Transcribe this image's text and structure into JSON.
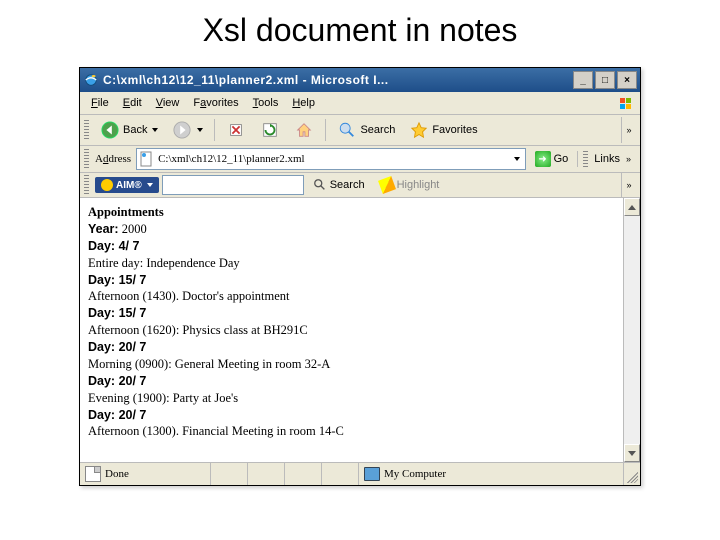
{
  "slide_title": "Xsl document in notes",
  "window": {
    "title": "C:\\xml\\ch12\\12_11\\planner2.xml - Microsoft I...",
    "min_label": "_",
    "max_label": "□",
    "close_label": "×"
  },
  "menu": {
    "file": "File",
    "edit": "Edit",
    "view": "View",
    "favorites": "Favorites",
    "tools": "Tools",
    "help": "Help"
  },
  "toolbar": {
    "back": "Back",
    "search": "Search",
    "favorites": "Favorites",
    "overflow": "»"
  },
  "address": {
    "label": "Address",
    "value": "C:\\xml\\ch12\\12_11\\planner2.xml",
    "go": "Go",
    "links": "Links",
    "overflow": "»"
  },
  "aim": {
    "brand": "AIM®",
    "search": "Search",
    "highlight": "Highlight",
    "overflow": "»"
  },
  "content": {
    "heading": "Appointments",
    "year_label": "Year:",
    "year_value": "2000",
    "entries": [
      {
        "day": "Day: 4/ 7",
        "line": "Entire day: Independence Day"
      },
      {
        "day": "Day: 15/ 7",
        "line": "Afternoon (1430). Doctor's appointment"
      },
      {
        "day": "Day: 15/ 7",
        "line": "Afternoon (1620): Physics class at BH291C"
      },
      {
        "day": "Day: 20/ 7",
        "line": "Morning (0900): General Meeting in room 32-A"
      },
      {
        "day": "Day: 20/ 7",
        "line": "Evening (1900): Party at Joe's"
      },
      {
        "day": "Day: 20/ 7",
        "line": "Afternoon (1300). Financial Meeting in room 14-C"
      }
    ]
  },
  "status": {
    "done": "Done",
    "zone": "My Computer"
  }
}
